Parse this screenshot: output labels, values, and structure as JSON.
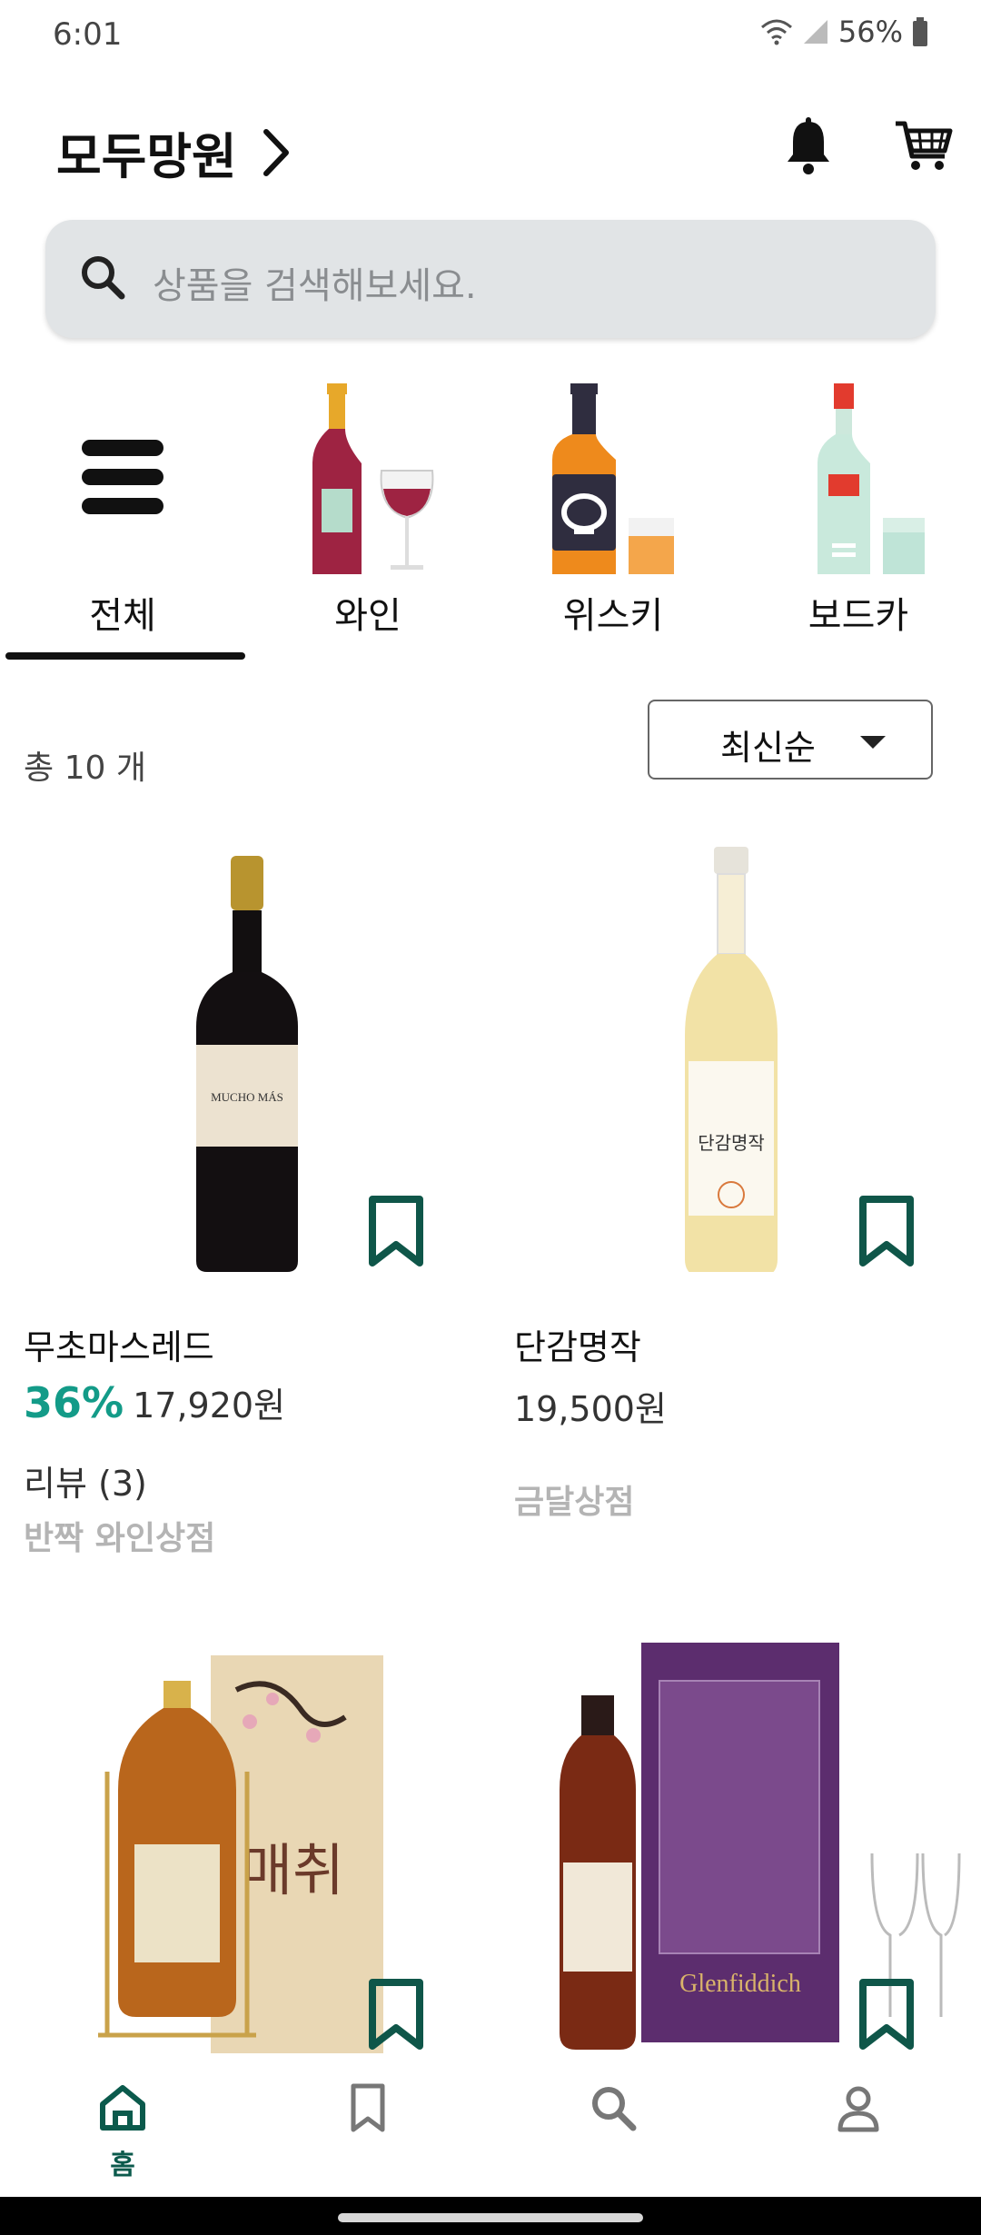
{
  "status_bar": {
    "time": "6:01",
    "battery": "56%"
  },
  "header": {
    "store_name": "모두망원"
  },
  "search": {
    "placeholder": "상품을 검색해보세요."
  },
  "categories": [
    {
      "label": "전체",
      "icon": "menu-icon",
      "selected": true
    },
    {
      "label": "와인",
      "icon": "wine-icon"
    },
    {
      "label": "위스키",
      "icon": "whiskey-icon"
    },
    {
      "label": "보드카",
      "icon": "vodka-icon"
    }
  ],
  "list": {
    "count_text": "총 10 개",
    "sort_label": "최신순"
  },
  "products": [
    {
      "name": "무초마스레드",
      "discount": "36%",
      "price": "17,920원",
      "review": "리뷰 (3)",
      "shop": "반짝 와인상점",
      "label_text": "MUCHO MÁS"
    },
    {
      "name": "단감명작",
      "discount": "",
      "price": "19,500원",
      "review": "",
      "shop": "금달상점",
      "label_text": "단감명작"
    },
    {
      "name": "",
      "label_text": "매취"
    },
    {
      "name": "",
      "label_text": "Glenfiddich"
    }
  ],
  "colors": {
    "accent": "#139b88",
    "nav_active": "#0b5a4c",
    "bookmark": "#0f5649"
  },
  "bottom_nav": {
    "home_label": "홈"
  }
}
